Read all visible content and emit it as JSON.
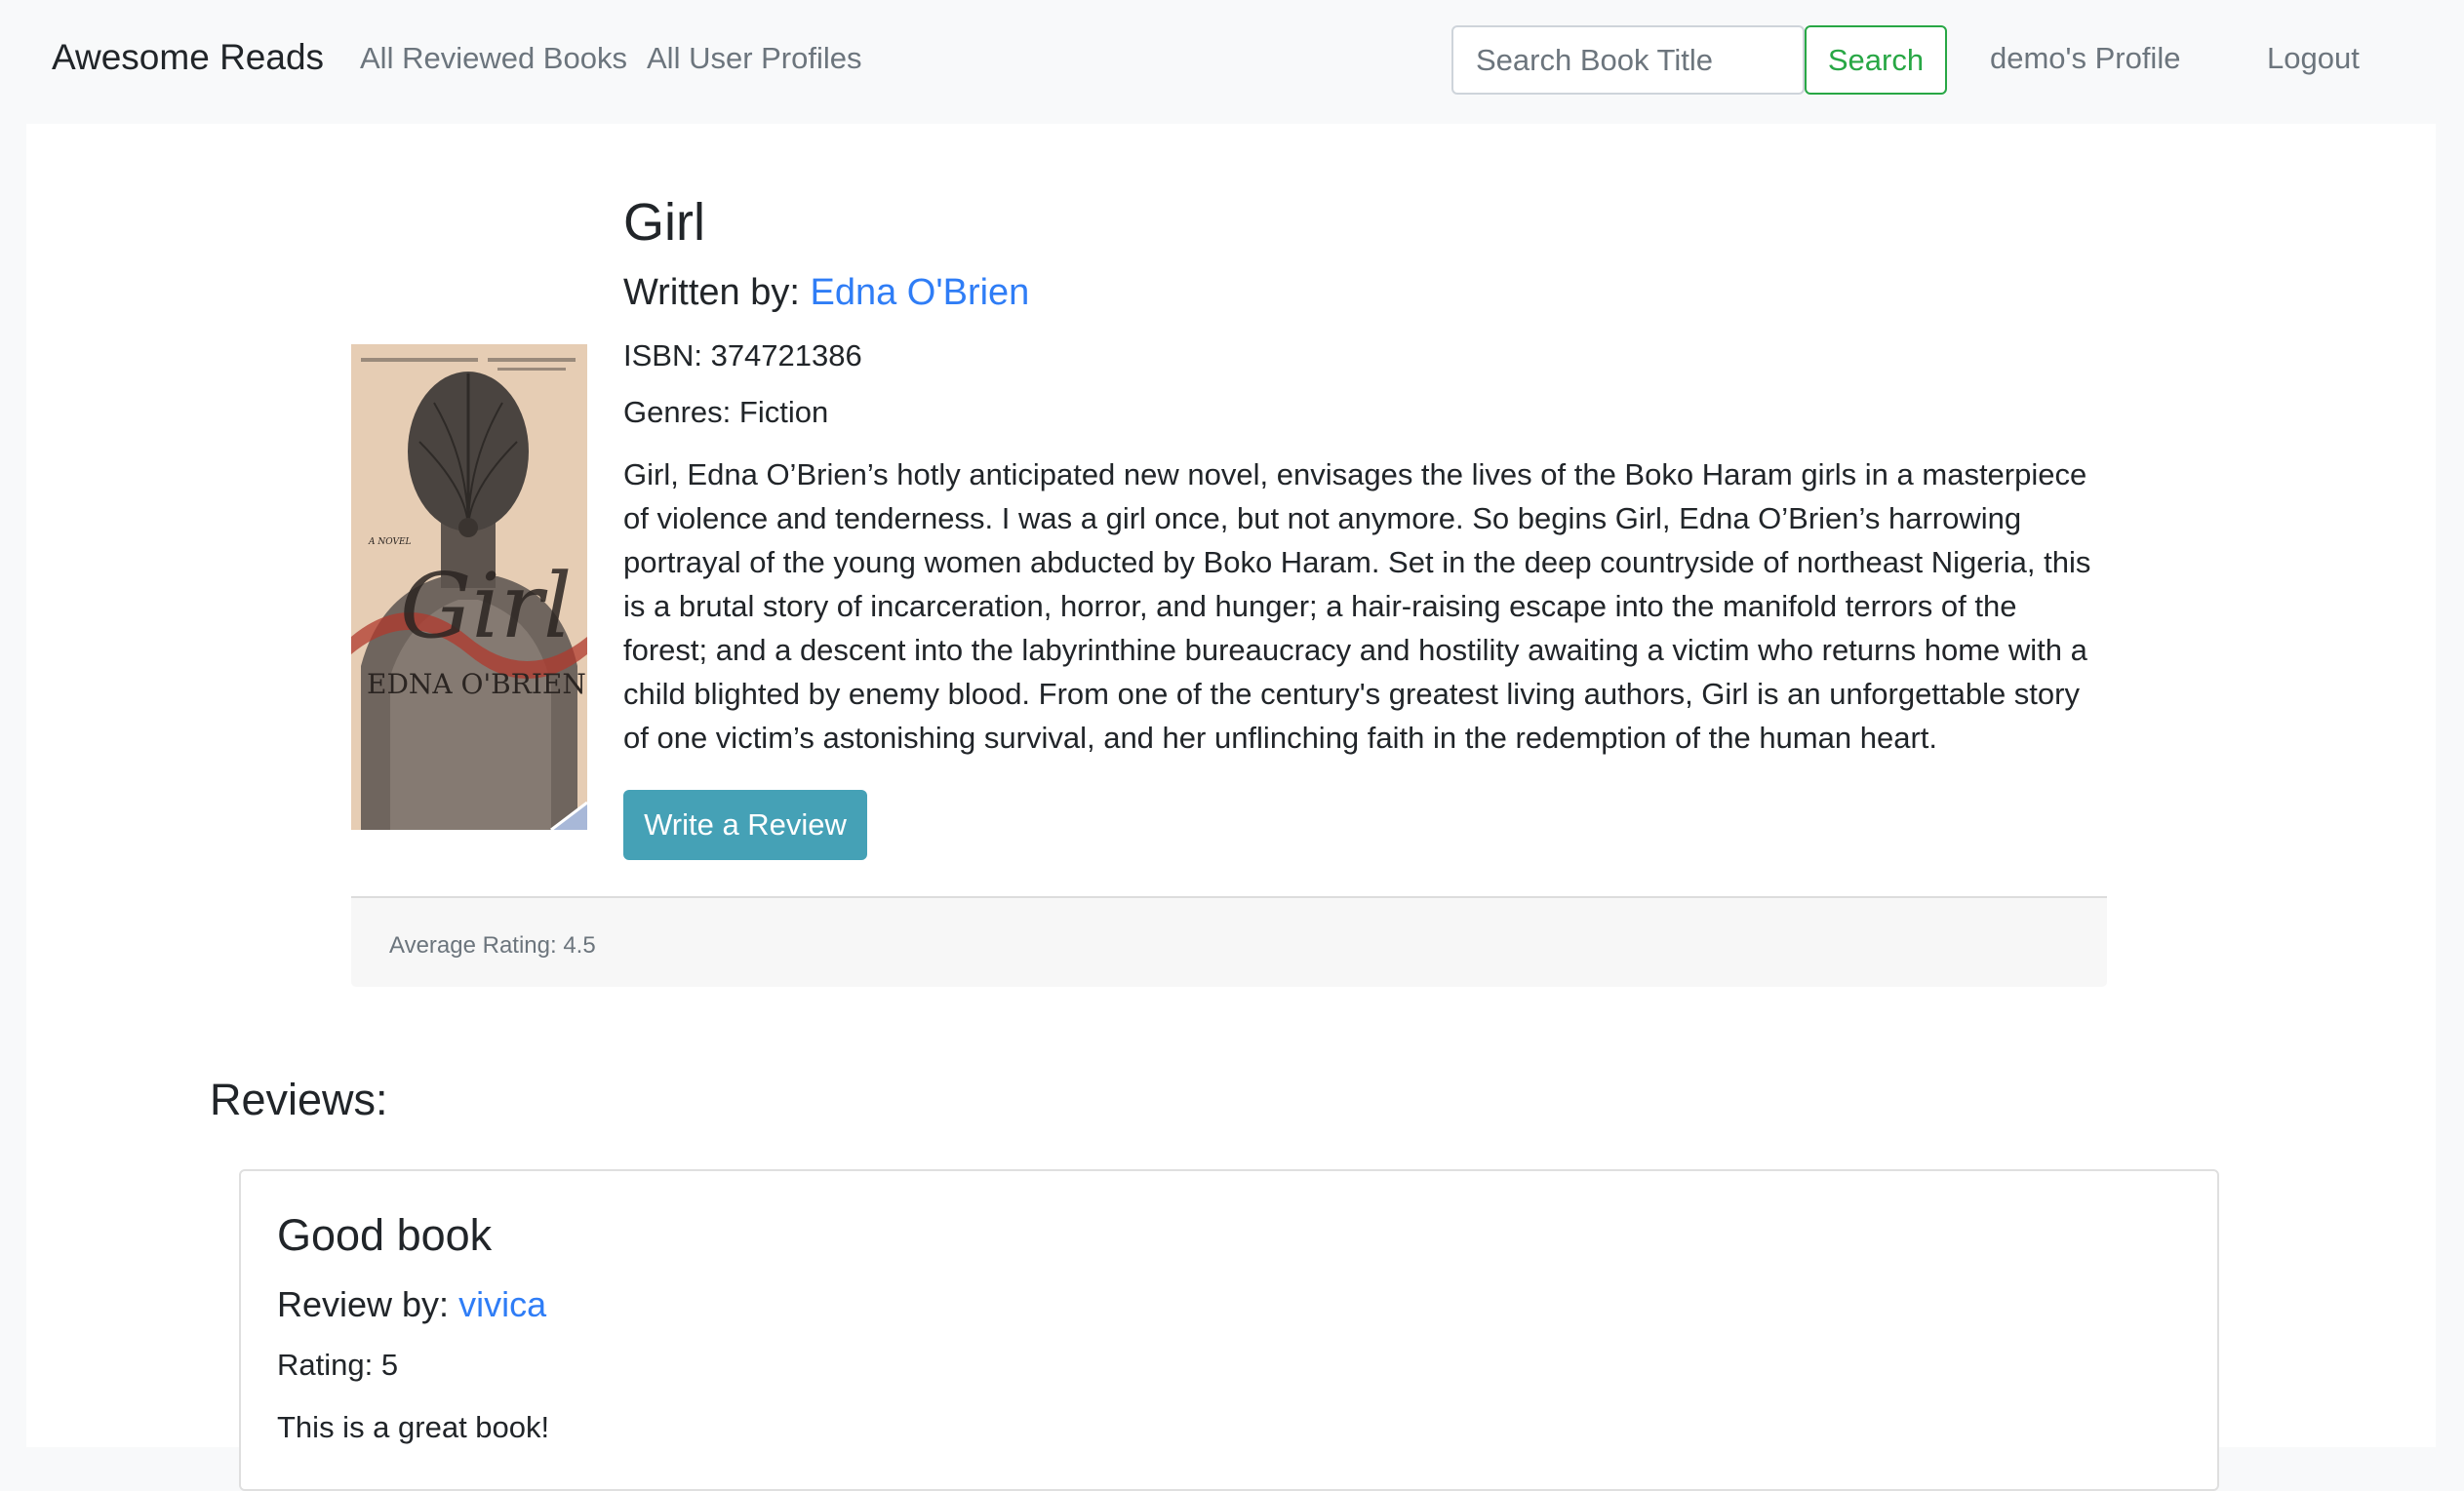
{
  "navbar": {
    "brand": "Awesome Reads",
    "links": [
      "All Reviewed Books",
      "All User Profiles"
    ],
    "search_placeholder": "Search Book Title",
    "search_button": "Search",
    "profile_link": "demo's Profile",
    "logout_link": "Logout"
  },
  "book": {
    "title": "Girl",
    "written_by_label": "Written by:",
    "author": "Edna O'Brien",
    "isbn": "ISBN: 374721386",
    "genres": "Genres: Fiction",
    "description": "Girl, Edna O’Brien’s hotly anticipated new novel, envisages the lives of the Boko Haram girls in a masterpiece of violence and tenderness. I was a girl once, but not anymore. So begins Girl, Edna O’Brien’s harrowing portrayal of the young women abducted by Boko Haram. Set in the deep countryside of northeast Nigeria, this is a brutal story of incarceration, horror, and hunger; a hair-raising escape into the manifold terrors of the forest; and a descent into the labyrinthine bureaucracy and hostility awaiting a victim who returns home with a child blighted by enemy blood. From one of the century's greatest living authors, Girl is an unforgettable story of one victim’s astonishing survival, and her unflinching faith in the redemption of the human heart.",
    "write_review_button": "Write a Review",
    "average_rating": "Average Rating: 4.5",
    "cover": {
      "title_text": "Girl",
      "author_text": "EDNA O'BRIEN",
      "tag_text": "A NOVEL"
    }
  },
  "reviews_heading": "Reviews:",
  "reviews": [
    {
      "title": "Good book",
      "by_label": "Review by:",
      "reviewer": "vivica",
      "rating": "Rating: 5",
      "text": "This is a great book!"
    }
  ],
  "colors": {
    "link": "#2f7df6",
    "success": "#28a745",
    "info_button": "#45a1b6",
    "navbar_bg": "#f8f9fa"
  }
}
